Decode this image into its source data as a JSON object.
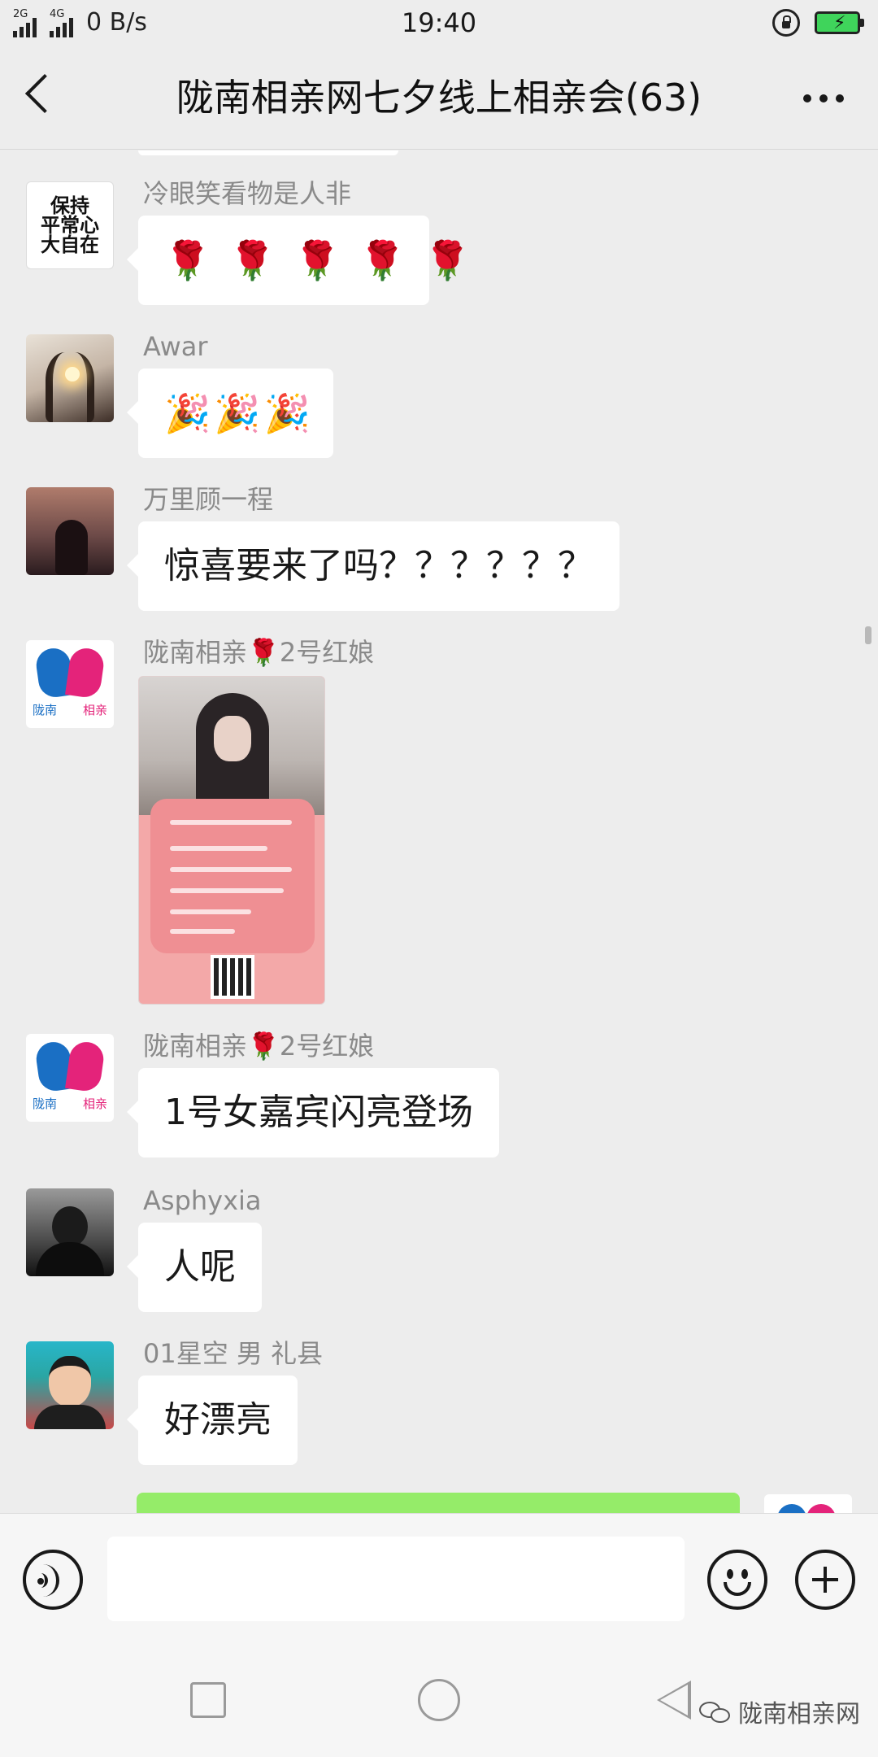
{
  "status_bar": {
    "net_left": "2G",
    "net_right": "4G",
    "speed": "0 B/s",
    "time": "19:40",
    "battery_color": "#3fd45b"
  },
  "header": {
    "title": "陇南相亲网七夕线上相亲会(63)",
    "back_icon": "chevron-left-icon",
    "more_icon": "more-dots-icon"
  },
  "messages": [
    {
      "sender": "冷眼笑看物是人非",
      "type": "emoji",
      "text": "🌹 🌹 🌹 🌹 🌹",
      "avatar_text": [
        "保持",
        "平常心",
        "大自在"
      ]
    },
    {
      "sender": "Awar",
      "type": "emoji",
      "text": "🎉🎉🎉"
    },
    {
      "sender": "万里顾一程",
      "type": "text",
      "text": "惊喜要来了吗？？？？？？"
    },
    {
      "sender": "陇南相亲🌹2号红娘",
      "type": "image",
      "avatar_caption": [
        "陇南",
        "相亲"
      ]
    },
    {
      "sender": "陇南相亲🌹2号红娘",
      "type": "text",
      "text": "1号女嘉宾闪亮登场",
      "avatar_caption": [
        "陇南",
        "相亲"
      ]
    },
    {
      "sender": "Asphyxia",
      "type": "text",
      "text": "人呢"
    },
    {
      "sender": "01星空  男  礼县",
      "type": "text",
      "text": "好漂亮"
    }
  ],
  "own_bubble_color": "#95ec69",
  "input_bar": {
    "voice_icon": "voice-icon",
    "emoji_icon": "smiley-icon",
    "plus_icon": "plus-icon",
    "placeholder": ""
  },
  "nav_bar": {
    "recent_icon": "square-icon",
    "home_icon": "circle-icon",
    "back_icon": "triangle-back-icon"
  },
  "watermark": "陇南相亲网"
}
